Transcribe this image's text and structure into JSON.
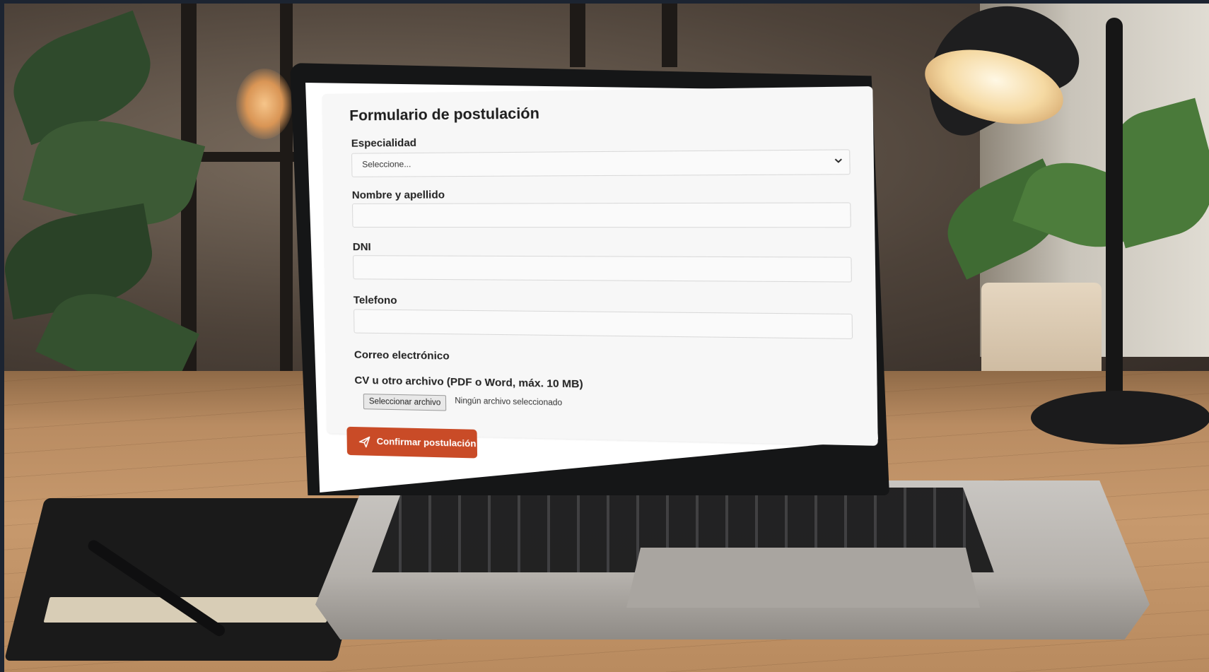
{
  "form": {
    "title": "Formulario de postulación",
    "especialidad": {
      "label": "Especialidad",
      "selected": "Seleccione..."
    },
    "nombre": {
      "label": "Nombre y apellido",
      "value": ""
    },
    "dni": {
      "label": "DNI",
      "value": ""
    },
    "telefono": {
      "label": "Telefono",
      "value": ""
    },
    "correo": {
      "label": "Correo electrónico"
    },
    "cv": {
      "label": "CV u otro archivo (PDF o Word, máx. 10 MB)",
      "button": "Seleccionar archivo",
      "status": "Ningún archivo seleccionado"
    },
    "submit": "Confirmar postulación"
  },
  "colors": {
    "accent": "#c94b27",
    "card": "#f7f7f7"
  },
  "icons": {
    "select_arrow": "chevron-down-icon",
    "submit": "send-icon"
  }
}
